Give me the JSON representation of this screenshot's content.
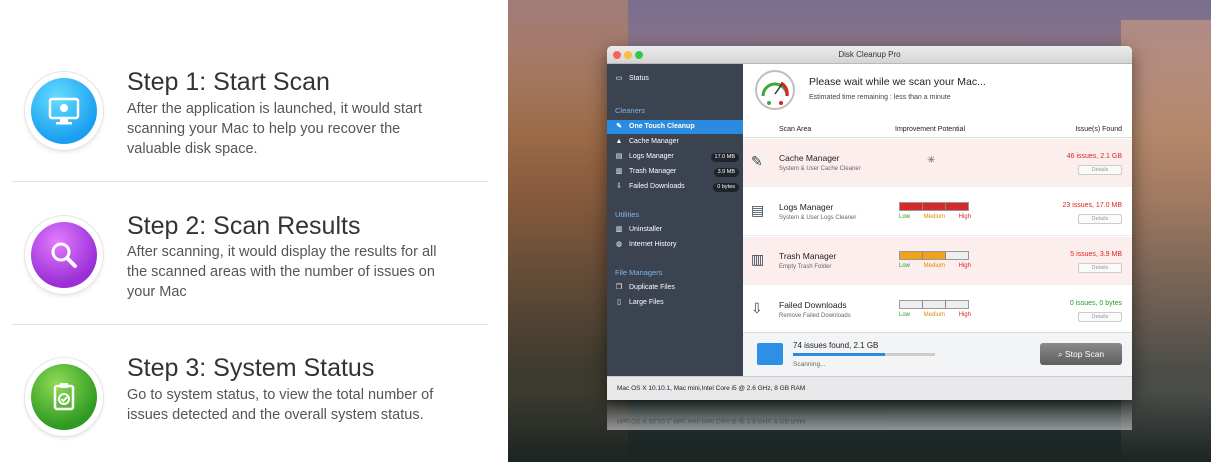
{
  "steps": [
    {
      "title": "Step 1: Start Scan",
      "desc": "After the application is launched, it would start scanning your Mac to help you recover the valuable disk space.",
      "icon": "mac-monitor-icon"
    },
    {
      "title": "Step 2: Scan Results",
      "desc": "After scanning, it would display the results for all the scanned areas with the number of issues on your Mac",
      "icon": "magnifier-icon"
    },
    {
      "title": "Step 3: System Status",
      "desc": "Go to system status, to view the total number of issues detected and the overall system status.",
      "icon": "clipboard-check-icon"
    }
  ],
  "app": {
    "window_title": "Disk Cleanup Pro",
    "sidebar": {
      "status": "Status",
      "sections": {
        "cleaners": "Cleaners",
        "utilities": "Utilities",
        "file_managers": "File Managers"
      },
      "cleaners": [
        {
          "label": "One Touch Cleanup",
          "badge": ""
        },
        {
          "label": "Cache Manager",
          "badge": ""
        },
        {
          "label": "Logs Manager",
          "badge": "17.0 MB"
        },
        {
          "label": "Trash Manager",
          "badge": "3.9 MB"
        },
        {
          "label": "Failed Downloads",
          "badge": "0 bytes"
        }
      ],
      "utilities": [
        {
          "label": "Uninstaller"
        },
        {
          "label": "Internet History"
        }
      ],
      "file_managers": [
        {
          "label": "Duplicate Files"
        },
        {
          "label": "Large Files"
        }
      ]
    },
    "scan": {
      "message": "Please wait while we scan your Mac...",
      "estimate": "Estimated time remaining : less than a minute"
    },
    "table": {
      "headers": [
        "Scan Area",
        "Improvement Potential",
        "Issue(s) Found"
      ],
      "level_labels": [
        "Low",
        "Medium",
        "High"
      ],
      "details_label": "Details",
      "rows": [
        {
          "title": "Cache Manager",
          "sub": "System & User Cache Cleaner",
          "issues": "46 issues, 2.1 GB",
          "issue_color": "#d22",
          "level": "scanning",
          "fill_color": ""
        },
        {
          "title": "Logs Manager",
          "sub": "System & User Logs Cleaner",
          "issues": "23 issues, 17.0 MB",
          "issue_color": "#d22",
          "level": 3,
          "fill_color": "#d42a2a"
        },
        {
          "title": "Trash Manager",
          "sub": "Empty Trash Folder",
          "issues": "5 issues, 3.9 MB",
          "issue_color": "#d22",
          "level": 2,
          "fill_color": "#f0a21a"
        },
        {
          "title": "Failed Downloads",
          "sub": "Remove Failed Downloads",
          "issues": "0 issues, 0 bytes",
          "issue_color": "#2a9a2a",
          "level": 0,
          "fill_color": ""
        }
      ]
    },
    "footer": {
      "found": "74 issues found, 2.1 GB",
      "progress": 0.65,
      "scanning": "Scanning...",
      "stop_label": "Stop Scan"
    },
    "statusbar": "Mac OS X 10.10.1, Mac mini,Intel Core i5 @ 2.6 GHz, 8 GB RAM"
  },
  "colors": {
    "accent": "#2b8be0",
    "sidebar_bg": "#3b4350",
    "low": "#2a9a2a",
    "medium": "#e08a00",
    "high": "#d22"
  }
}
